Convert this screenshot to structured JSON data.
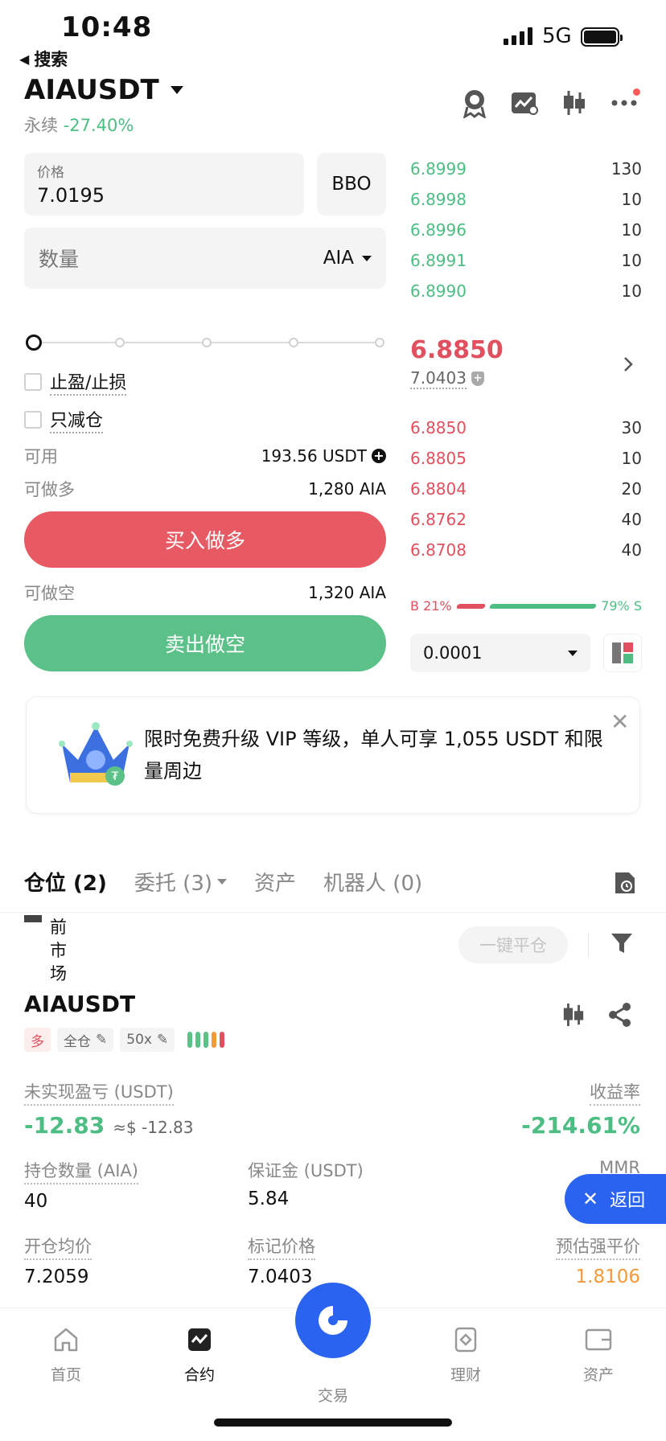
{
  "status_bar": {
    "time": "10:48",
    "network": "5G",
    "back_label": "搜索"
  },
  "header": {
    "symbol": "AIAUSDT",
    "contract_type": "永续",
    "change_pct": "-27.40%"
  },
  "order_form": {
    "price_label": "价格",
    "price_value": "7.0195",
    "bbo_label": "BBO",
    "qty_label": "数量",
    "qty_unit": "AIA",
    "tp_sl_label": "止盈/止损",
    "reduce_only_label": "只减仓",
    "available_label": "可用",
    "available_value": "193.56 USDT",
    "max_long_label": "可做多",
    "max_long_value": "1,280 AIA",
    "buy_button": "买入做多",
    "max_short_label": "可做空",
    "max_short_value": "1,320 AIA",
    "sell_button": "卖出做空"
  },
  "order_book": {
    "asks": [
      {
        "price": "6.8999",
        "qty": "130"
      },
      {
        "price": "6.8998",
        "qty": "10"
      },
      {
        "price": "6.8996",
        "qty": "10"
      },
      {
        "price": "6.8991",
        "qty": "10"
      },
      {
        "price": "6.8990",
        "qty": "10"
      }
    ],
    "last_price": "6.8850",
    "mark_price": "7.0403",
    "bids": [
      {
        "price": "6.8850",
        "qty": "30"
      },
      {
        "price": "6.8805",
        "qty": "10"
      },
      {
        "price": "6.8804",
        "qty": "20"
      },
      {
        "price": "6.8762",
        "qty": "40"
      },
      {
        "price": "6.8708",
        "qty": "40"
      }
    ],
    "buy_ratio_label": "B 21%",
    "sell_ratio_label": "79% S",
    "buy_ratio": 0.21,
    "step": "0.0001"
  },
  "banner": {
    "text": "限时免费升级 VIP 等级，单人可享 1,055 USDT 和限量周边"
  },
  "tabs": [
    {
      "label": "仓位 (2)"
    },
    {
      "label": "委托 (3)"
    },
    {
      "label": "资产"
    },
    {
      "label": "机器人 (0)"
    }
  ],
  "positions_toolbar": {
    "current_market_label": "前市场",
    "close_all_label": "一键平仓"
  },
  "position": {
    "symbol": "AIAUSDT",
    "side_tag": "多",
    "margin_mode_tag": "全仓",
    "leverage_tag": "50x",
    "pnl_label": "未实现盈亏 (USDT)",
    "pnl_value": "-12.83",
    "pnl_approx": "≈$ -12.83",
    "roe_label": "收益率",
    "roe_value": "-214.61%",
    "size_label": "持仓数量 (AIA)",
    "size_value": "40",
    "margin_label": "保证金 (USDT)",
    "margin_value": "5.84",
    "mmr_label": "MMR",
    "entry_label": "开仓均价",
    "entry_value": "7.2059",
    "mark_label": "标记价格",
    "mark_value": "7.0403",
    "liq_label": "预估强平价",
    "liq_value": "1.8106"
  },
  "return_button": "返回",
  "bottom_nav": [
    {
      "label": "首页"
    },
    {
      "label": "合约"
    },
    {
      "label": "交易"
    },
    {
      "label": "理财"
    },
    {
      "label": "资产"
    }
  ],
  "colors": {
    "green": "#4dbd84",
    "red": "#e0505e",
    "brand_blue": "#2a63f0",
    "orange": "#f39a3c"
  }
}
